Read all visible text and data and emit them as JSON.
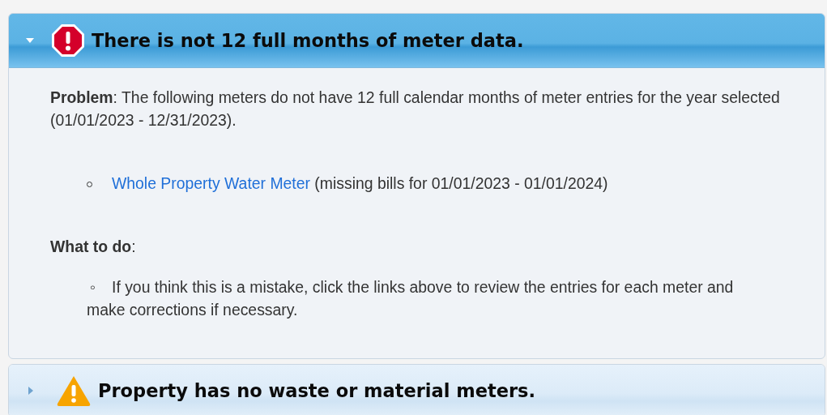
{
  "panels": [
    {
      "kind": "error",
      "expanded": true,
      "title": "There is not 12 full months of meter data.",
      "problem": "**Problem**: The following meters do not have 12 full calendar months of meter entries for the year selected (01/01/2023 - 12/31/2023).",
      "meters": [
        {
          "link": "Whole Property Water Meter",
          "detail": "(missing bills for 01/01/2023 - 01/01/2024)"
        }
      ],
      "todo_heading": "**What to do**:",
      "todo": [
        {
          "bullet": "◦",
          "text": "If you think this is a mistake, click the links above to review the entries for each meter and make corrections if necessary."
        }
      ]
    },
    {
      "kind": "warning",
      "expanded": false,
      "title": "Property has no waste or material meters."
    }
  ]
}
